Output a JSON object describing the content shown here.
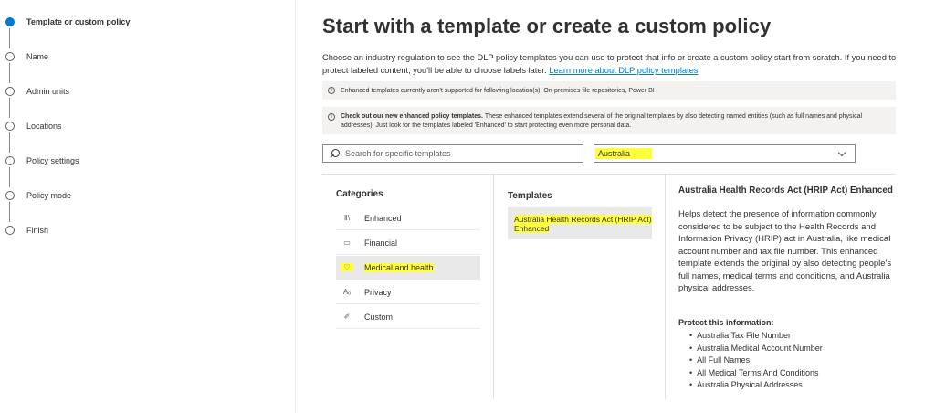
{
  "stepper": {
    "steps": [
      {
        "label": "Template or custom policy",
        "active": true
      },
      {
        "label": "Name",
        "active": false
      },
      {
        "label": "Admin units",
        "active": false
      },
      {
        "label": "Locations",
        "active": false
      },
      {
        "label": "Policy settings",
        "active": false
      },
      {
        "label": "Policy mode",
        "active": false
      },
      {
        "label": "Finish",
        "active": false
      }
    ]
  },
  "main": {
    "title": "Start with a template or create a custom policy",
    "description": "Choose an industry regulation to see the DLP policy templates you can use to protect that info or create a custom policy start from scratch. If you need to protect labeled content, you'll be able to choose labels later.",
    "learn_more": "Learn more about DLP policy templates",
    "banner1": "Enhanced templates currently aren't supported for following location(s): On-premises file repositories, Power BI",
    "banner2_bold": "Check out our new enhanced policy templates.",
    "banner2_text": "These enhanced templates extend several of the original templates by also detecting named entities (such as full names and physical addresses). Just look for the templates labeled 'Enhanced' to start protecting even more personal data.",
    "info_glyph": "i"
  },
  "search": {
    "placeholder": "Search for specific templates",
    "value": ""
  },
  "region": {
    "selected": "Australia"
  },
  "categories": {
    "title": "Categories",
    "items": [
      {
        "label": "Enhanced",
        "icon": "library-icon",
        "glyph": "Ⅱ\\",
        "selected": false
      },
      {
        "label": "Financial",
        "icon": "money-icon",
        "glyph": "▭",
        "selected": false
      },
      {
        "label": "Medical and health",
        "icon": "heart-icon",
        "glyph": "♡",
        "selected": true
      },
      {
        "label": "Privacy",
        "icon": "person-key-icon",
        "glyph": "Αₒ",
        "selected": false
      },
      {
        "label": "Custom",
        "icon": "pencil-icon",
        "glyph": "✐",
        "selected": false
      }
    ]
  },
  "templates": {
    "title": "Templates",
    "items": [
      {
        "label": "Australia Health Records Act (HRIP Act) Enhanced"
      }
    ]
  },
  "detail": {
    "title": "Australia Health Records Act (HRIP Act) Enhanced",
    "description": "Helps detect the presence of information commonly considered to be subject to the Health Records and Information Privacy (HRIP) act in Australia, like medical account number and tax file number. This enhanced template extends the original by also detecting people's full names, medical terms and conditions, and Australia physical addresses.",
    "protect_title": "Protect this information:",
    "protect_items": [
      "Australia Tax File Number",
      "Australia Medical Account Number",
      "All Full Names",
      "All Medical Terms And Conditions",
      "Australia Physical Addresses"
    ]
  },
  "colors": {
    "accent": "#0078d4",
    "highlight": "#ffff3b",
    "banner_bg": "#f3f2f1",
    "selected_bg": "#e9e9e9"
  }
}
